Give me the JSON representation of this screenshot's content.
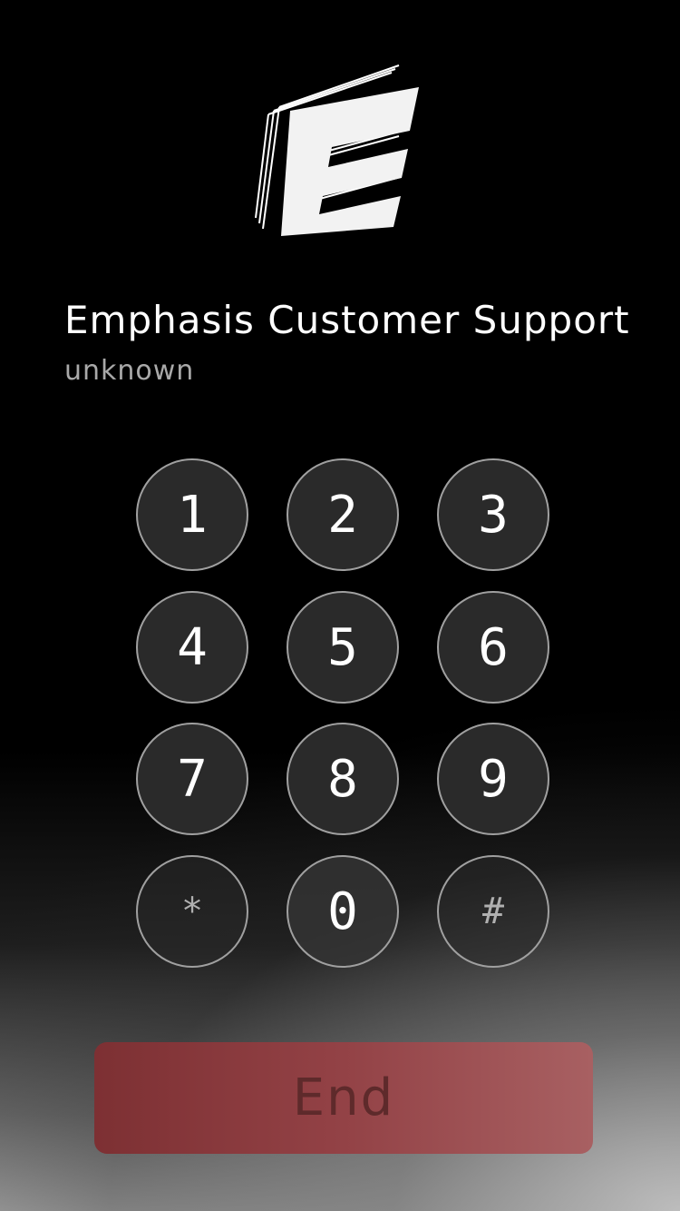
{
  "call": {
    "logo": "emphasis-e-logo-icon",
    "caller_name": "Emphasis Customer Support",
    "status": "unknown"
  },
  "keypad": {
    "keys": [
      "1",
      "2",
      "3",
      "4",
      "5",
      "6",
      "7",
      "8",
      "9",
      "*",
      "0",
      "#"
    ]
  },
  "actions": {
    "end_label": "End"
  },
  "colors": {
    "end_button": "#934246",
    "key_fill": "#2a2a2a",
    "key_border": "#a0a0a0"
  }
}
